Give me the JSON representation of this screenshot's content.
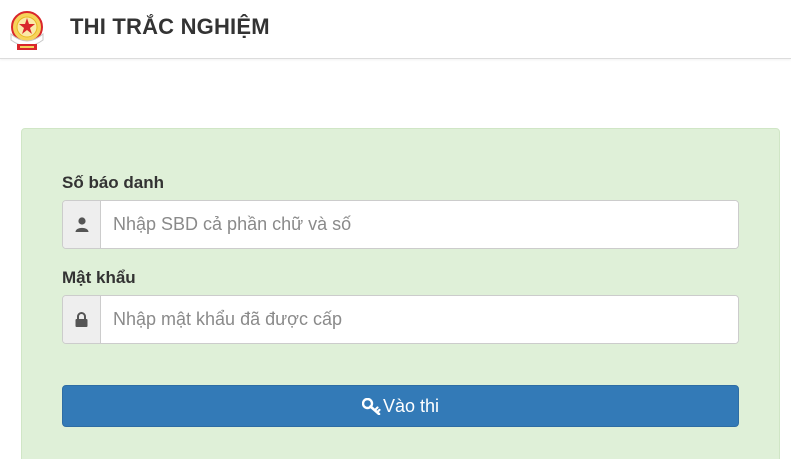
{
  "header": {
    "title": "THI TRẮC NGHIỆM",
    "logo_icon": "school-emblem-logo"
  },
  "form": {
    "candidate_id": {
      "label": "Số báo danh",
      "placeholder": "Nhập SBD cả phần chữ và số",
      "value": "",
      "icon": "user-icon"
    },
    "password": {
      "label": "Mật khẩu",
      "placeholder": "Nhập mật khẩu đã được cấp",
      "value": "",
      "icon": "lock-icon"
    },
    "submit": {
      "label": "Vào thi",
      "icon": "key-icon"
    }
  },
  "colors": {
    "panel_background": "#dff0d8",
    "button_primary": "#337ab7",
    "logo_red": "#d9262b",
    "logo_gold": "#e8b923"
  }
}
